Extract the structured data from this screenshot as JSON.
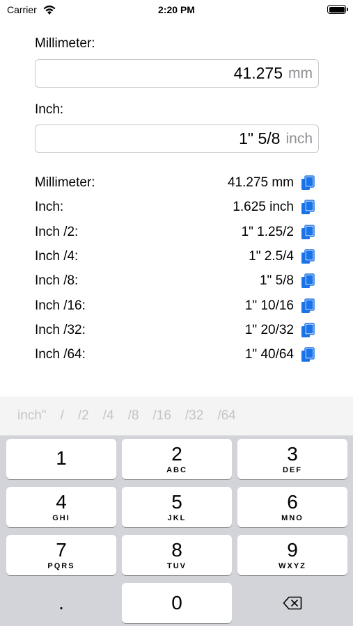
{
  "status_bar": {
    "carrier": "Carrier",
    "time": "2:20 PM"
  },
  "fields": {
    "millimeter": {
      "label": "Millimeter:",
      "value": "41.275",
      "unit": "mm"
    },
    "inch": {
      "label": "Inch:",
      "value": "1\" 5/8",
      "unit": "inch"
    }
  },
  "results": [
    {
      "label": "Millimeter:",
      "value": "41.275 mm"
    },
    {
      "label": "Inch:",
      "value": "1.625 inch"
    },
    {
      "label": "Inch  /2:",
      "value": "1\" 1.25/2"
    },
    {
      "label": "Inch  /4:",
      "value": "1\" 2.5/4"
    },
    {
      "label": "Inch  /8:",
      "value": "1\" 5/8"
    },
    {
      "label": "Inch  /16:",
      "value": "1\" 10/16"
    },
    {
      "label": "Inch  /32:",
      "value": "1\" 20/32"
    },
    {
      "label": "Inch  /64:",
      "value": "1\" 40/64"
    }
  ],
  "suggestions": [
    "inch\"",
    "/",
    "/2",
    "/4",
    "/8",
    "/16",
    "/32",
    "/64"
  ],
  "keyboard": {
    "keys": [
      {
        "num": "1",
        "letters": ""
      },
      {
        "num": "2",
        "letters": "ABC"
      },
      {
        "num": "3",
        "letters": "DEF"
      },
      {
        "num": "4",
        "letters": "GHI"
      },
      {
        "num": "5",
        "letters": "JKL"
      },
      {
        "num": "6",
        "letters": "MNO"
      },
      {
        "num": "7",
        "letters": "PQRS"
      },
      {
        "num": "8",
        "letters": "TUV"
      },
      {
        "num": "9",
        "letters": "WXYZ"
      }
    ],
    "decimal": ".",
    "zero": "0"
  },
  "colors": {
    "accent": "#1a73e8",
    "keyboard_bg": "#d2d4d9",
    "placeholder_gray": "#8e8e93"
  }
}
